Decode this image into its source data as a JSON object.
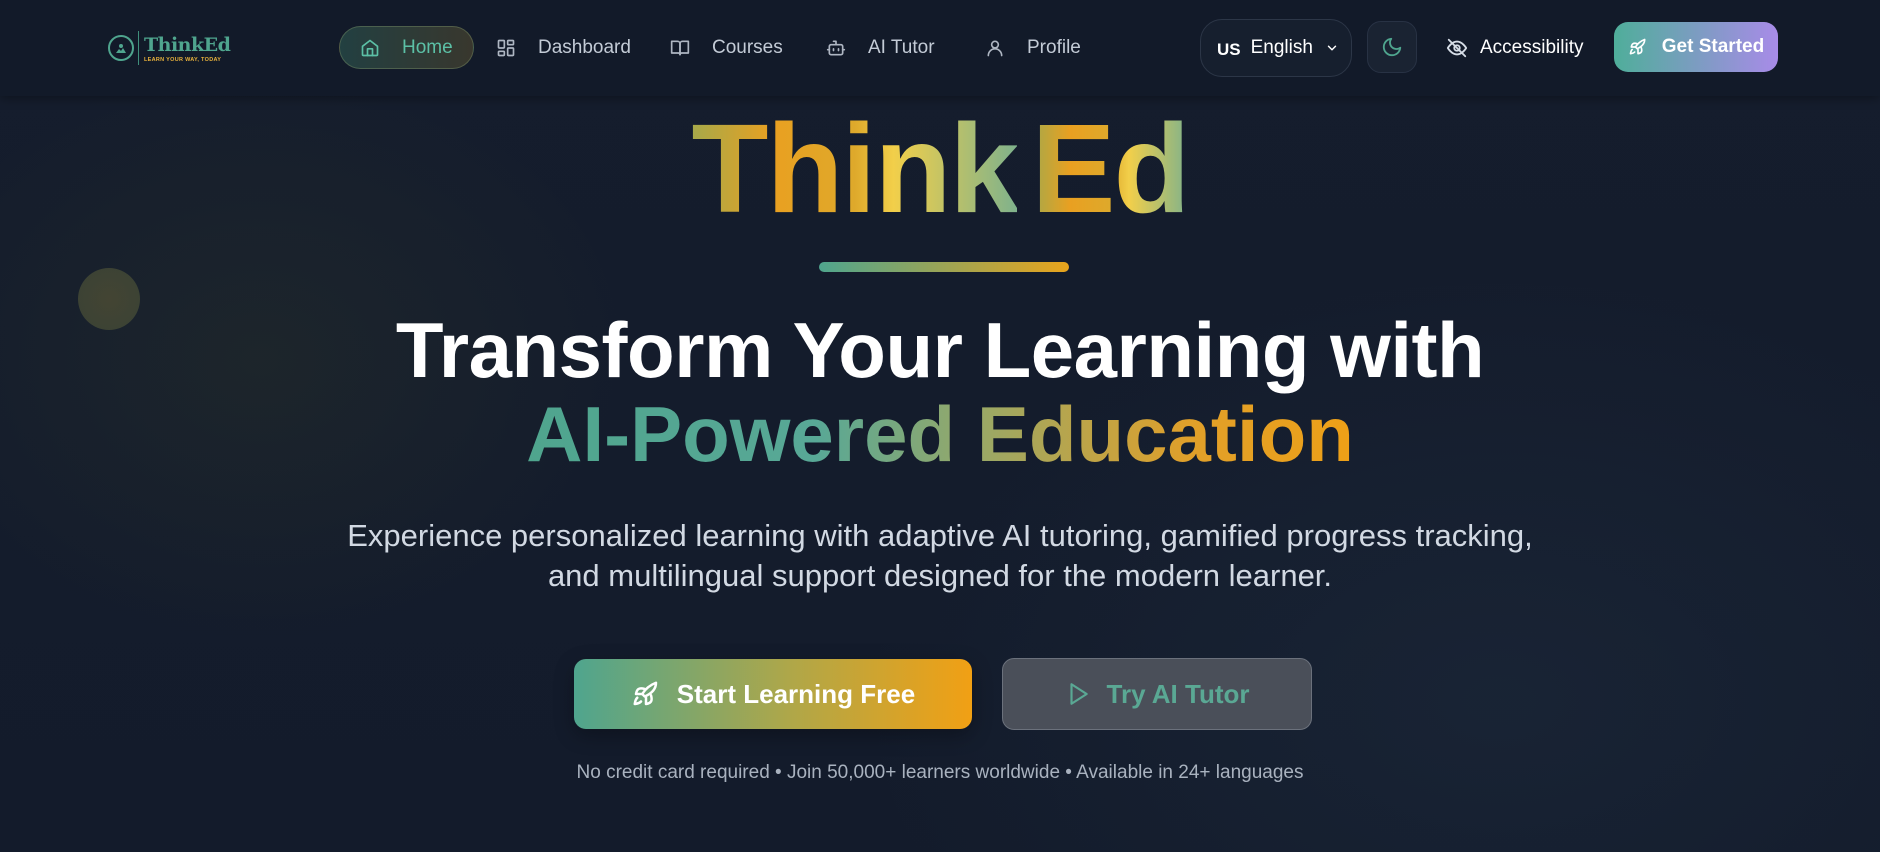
{
  "nav": {
    "logo": {
      "name": "ThinkEd",
      "tagline": "LEARN YOUR WAY, TODAY"
    },
    "items": [
      {
        "label": "Home",
        "icon": "home-icon",
        "active": true
      },
      {
        "label": "Dashboard",
        "icon": "dashboard-icon",
        "active": false
      },
      {
        "label": "Courses",
        "icon": "book-icon",
        "active": false
      },
      {
        "label": "AI Tutor",
        "icon": "bot-icon",
        "active": false
      },
      {
        "label": "Profile",
        "icon": "user-icon",
        "active": false
      }
    ],
    "language": {
      "flag": "US",
      "label": "English"
    },
    "theme_icon": "moon-icon",
    "accessibility_label": "Accessibility",
    "get_started_label": "Get Started"
  },
  "hero": {
    "brand_part1": "Think",
    "brand_part2": "Ed",
    "headline_line1": "Transform Your Learning with",
    "headline_line2": "AI-Powered Education",
    "subtext": "Experience personalized learning with adaptive AI tutoring, gamified progress tracking, and multilingual support designed for the modern learner.",
    "primary_cta": "Start Learning Free",
    "secondary_cta": "Try AI Tutor",
    "footnote": "No credit card required • Join 50,000+ learners worldwide • Available in 24+ languages"
  },
  "colors": {
    "background": "#141c2c",
    "accent_teal": "#4fa58e",
    "accent_orange": "#f1a014",
    "accent_purple": "#a88be8"
  }
}
